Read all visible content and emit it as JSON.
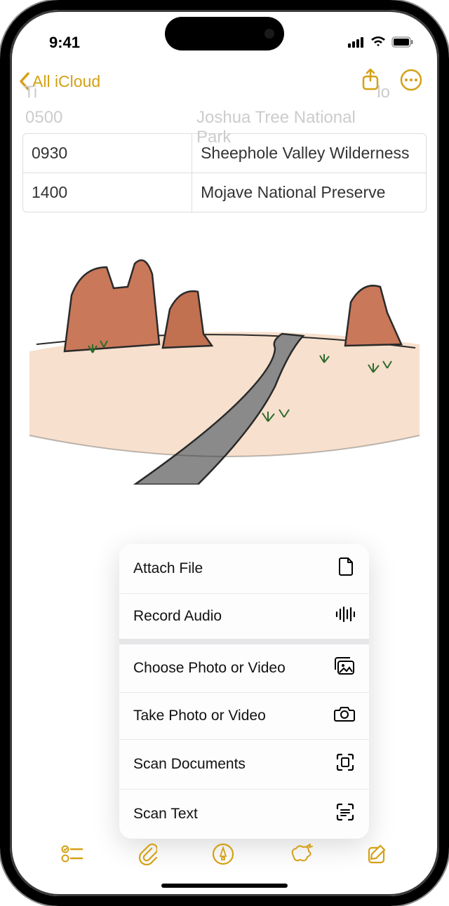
{
  "status": {
    "time": "9:41"
  },
  "nav": {
    "back_label": "All iCloud"
  },
  "faded": {
    "header_left": "Ti",
    "header_right": "lo",
    "row0_time": "0500",
    "row0_loc": "Joshua Tree National Park"
  },
  "table": {
    "rows": [
      {
        "time": "0930",
        "location": "Sheephole Valley Wilderness"
      },
      {
        "time": "1400",
        "location": "Mojave National Preserve"
      }
    ]
  },
  "menu": {
    "group1": [
      {
        "label": "Attach File",
        "icon": "file-icon"
      },
      {
        "label": "Record Audio",
        "icon": "waveform-icon"
      }
    ],
    "group2": [
      {
        "label": "Choose Photo or Video",
        "icon": "photo-library-icon"
      },
      {
        "label": "Take Photo or Video",
        "icon": "camera-icon"
      },
      {
        "label": "Scan Documents",
        "icon": "scan-doc-icon"
      },
      {
        "label": "Scan Text",
        "icon": "scan-text-icon"
      }
    ]
  },
  "colors": {
    "accent": "#d4a015"
  }
}
